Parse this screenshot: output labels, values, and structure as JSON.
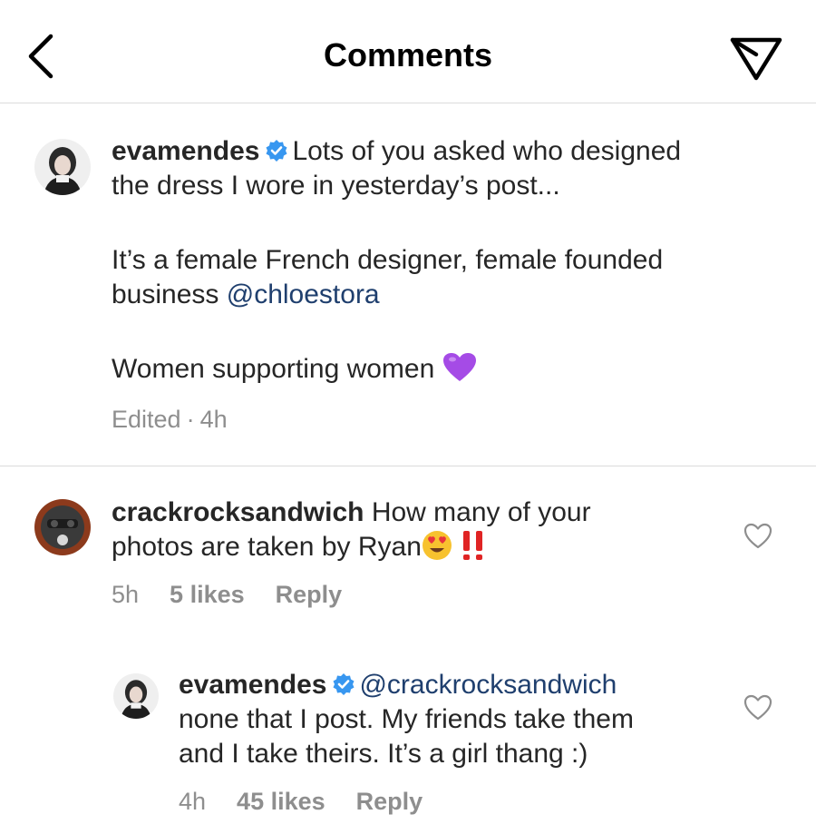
{
  "header": {
    "title": "Comments",
    "back_icon": "chevron-left-icon",
    "share_icon": "paper-plane-icon"
  },
  "caption": {
    "username": "evamendes",
    "line1_text": "Lots of you asked who designed",
    "line2_text": "the dress I wore in yesterday’s post...",
    "para2_text": "It’s a female French designer, female founded",
    "para2_line2_text": "business",
    "mention": "@chloestora",
    "para3_text": "Women supporting women",
    "emoji": "purple-heart-icon",
    "meta_edited": "Edited",
    "meta_separator": "·",
    "meta_time": "4h"
  },
  "comments": [
    {
      "username": "crackrocksandwich",
      "line1_text": "How many of your",
      "line2_text": "photos are taken by Ryan",
      "emojis": [
        "heart-eyes-icon",
        "double-exclamation-icon"
      ],
      "time": "5h",
      "likes": "5 likes",
      "reply_label": "Reply"
    },
    {
      "username": "evamendes",
      "mention": "@crackrocksandwich",
      "line2_text": "none that I post. My friends take them",
      "line3_text": "and I take theirs.  It’s a girl thang :)",
      "time": "4h",
      "likes": "45 likes",
      "reply_label": "Reply"
    }
  ],
  "colors": {
    "text": "#262626",
    "muted": "#8e8e8e",
    "mention": "#1f3f6e",
    "verified": "#3897f0",
    "divider": "#dbdbdb"
  }
}
